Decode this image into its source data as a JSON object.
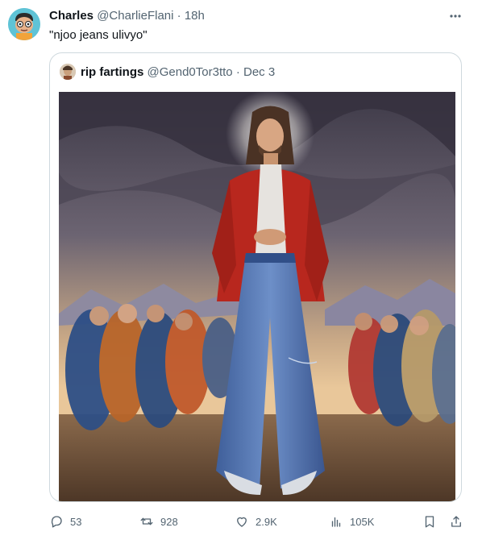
{
  "tweet": {
    "author_name": "Charles",
    "author_handle": "@CharlieFlani",
    "separator": "·",
    "time": "18h",
    "text": "\"njoo jeans ulivyo\""
  },
  "quoted": {
    "author_name": "rip fartings",
    "author_handle": "@Gend0Tor3tto",
    "separator": "·",
    "date": "Dec 3",
    "media_alt": "Painting of a long-haired man in a red cloak and very wide baggy jeans standing before a seated crowd under a stormy sky"
  },
  "actions": {
    "replies": "53",
    "reposts": "928",
    "likes": "2.9K",
    "views": "105K"
  },
  "icons": [
    "more-icon",
    "reply-icon",
    "repost-icon",
    "like-icon",
    "views-icon",
    "bookmark-icon",
    "share-icon"
  ],
  "colors": {
    "muted": "#536471",
    "text": "#0f1419",
    "border": "#cfd9de",
    "avatar_bg": "#5fc3d6"
  }
}
